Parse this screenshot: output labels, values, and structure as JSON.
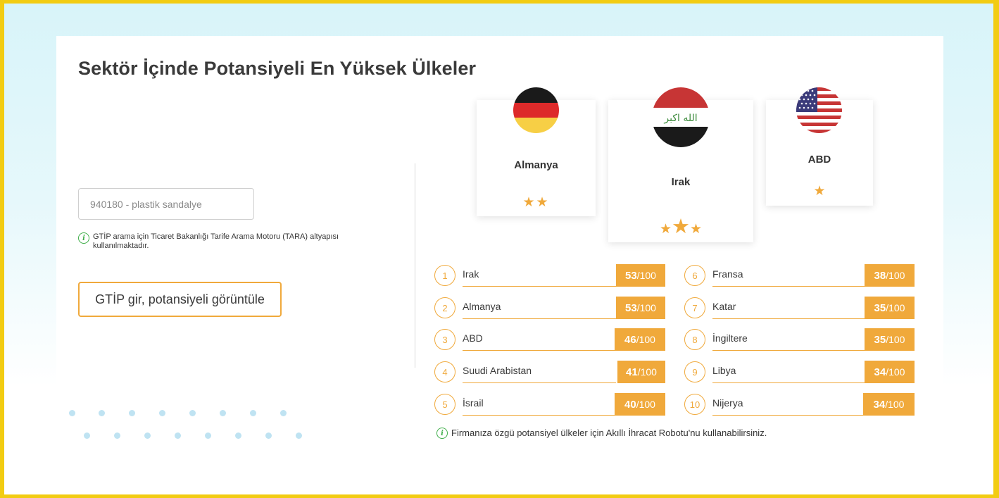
{
  "page": {
    "title": "Sektör İçinde Potansiyeli En Yüksek Ülkeler"
  },
  "search": {
    "placeholder": "940180 - plastik sandalye",
    "info_text": "GTİP arama için Ticaret Bakanlığı Tarife Arama Motoru (TARA) altyapısı kullanılmaktadır.",
    "button_label": "GTİP gir, potansiyeli görüntüle"
  },
  "podium": [
    {
      "name": "Almanya",
      "stars": 2,
      "flag": "germany-flag"
    },
    {
      "name": "Irak",
      "stars": 3,
      "flag": "iraq-flag"
    },
    {
      "name": "ABD",
      "stars": 1,
      "flag": "usa-flag"
    }
  ],
  "ranking": {
    "left": [
      {
        "rank": "1",
        "name": "Irak",
        "score": "53",
        "max": "/100"
      },
      {
        "rank": "2",
        "name": "Almanya",
        "score": "53",
        "max": "/100"
      },
      {
        "rank": "3",
        "name": "ABD",
        "score": "46",
        "max": "/100"
      },
      {
        "rank": "4",
        "name": "Suudi Arabistan",
        "score": "41",
        "max": "/100"
      },
      {
        "rank": "5",
        "name": "İsrail",
        "score": "40",
        "max": "/100"
      }
    ],
    "right": [
      {
        "rank": "6",
        "name": "Fransa",
        "score": "38",
        "max": "/100"
      },
      {
        "rank": "7",
        "name": "Katar",
        "score": "35",
        "max": "/100"
      },
      {
        "rank": "8",
        "name": "İngiltere",
        "score": "35",
        "max": "/100"
      },
      {
        "rank": "9",
        "name": "Libya",
        "score": "34",
        "max": "/100"
      },
      {
        "rank": "10",
        "name": "Nijerya",
        "score": "34",
        "max": "/100"
      }
    ]
  },
  "footer_note": "Firmanıza özgü potansiyel ülkeler için Akıllı İhracat Robotu'nu kullanabilirsiniz.",
  "colors": {
    "accent": "#f0a93b",
    "info": "#3fae49",
    "border": "#f2cc12"
  }
}
